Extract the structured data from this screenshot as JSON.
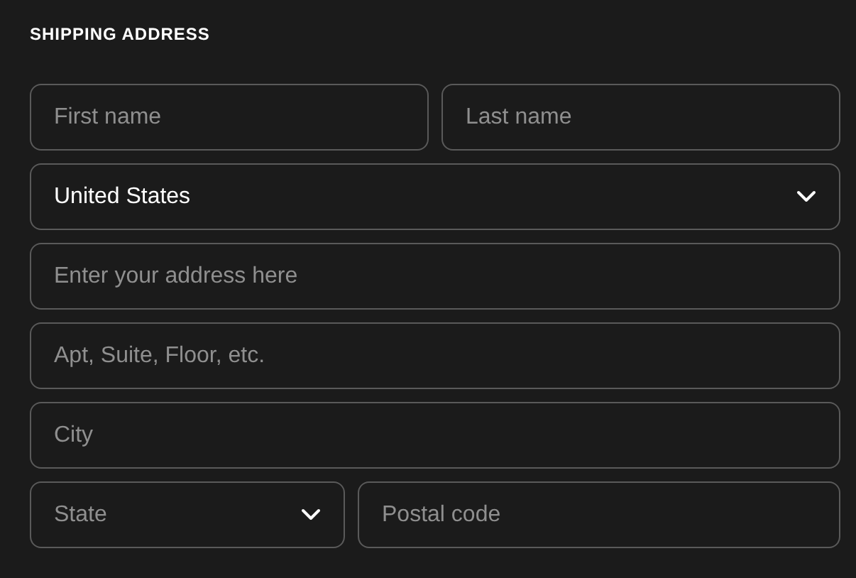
{
  "title": "SHIPPING ADDRESS",
  "rows": [
    [
      {
        "kind": "input",
        "placeholder": "First name"
      },
      {
        "kind": "input",
        "placeholder": "Last name"
      }
    ],
    [
      {
        "kind": "select",
        "value": "United States"
      }
    ],
    [
      {
        "kind": "input",
        "placeholder": "Enter your address here"
      }
    ],
    [
      {
        "kind": "input",
        "placeholder": "Apt, Suite, Floor, etc."
      }
    ],
    [
      {
        "kind": "input",
        "placeholder": "City"
      }
    ],
    [
      {
        "kind": "select",
        "placeholder": "State"
      },
      {
        "kind": "input",
        "placeholder": "Postal code"
      }
    ]
  ]
}
